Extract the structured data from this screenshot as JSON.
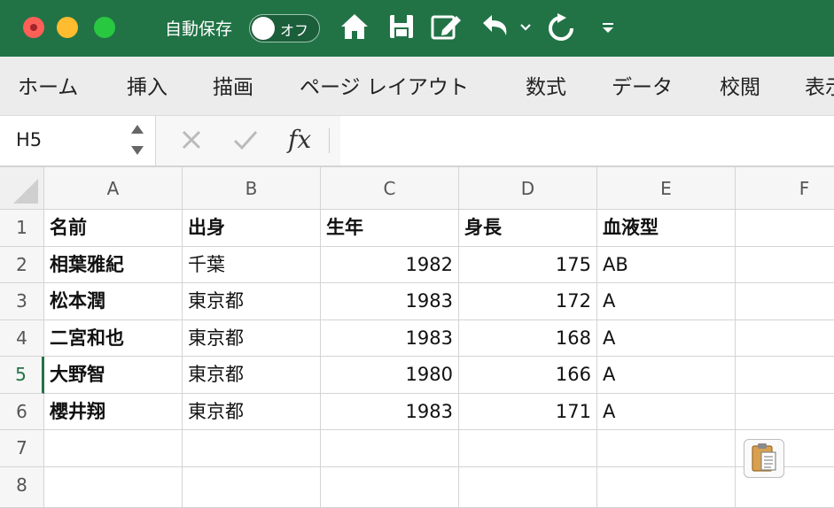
{
  "titlebar": {
    "autosave_label": "自動保存",
    "autosave_state": "オフ",
    "icons": [
      "home-icon",
      "save-icon",
      "edit-icon",
      "undo-icon",
      "undo-dropdown-icon",
      "redo-icon",
      "customize-toolbar-icon"
    ]
  },
  "ribbon": {
    "tabs": [
      "ホーム",
      "挿入",
      "描画",
      "ページ レイアウト",
      "数式",
      "データ",
      "校閲",
      "表示"
    ]
  },
  "formula_bar": {
    "cell_reference": "H5",
    "formula": ""
  },
  "sheet": {
    "columns": [
      "A",
      "B",
      "C",
      "D",
      "E",
      "F"
    ],
    "row_numbers": [
      "1",
      "2",
      "3",
      "4",
      "5",
      "6",
      "7",
      "8"
    ],
    "active_row": "5",
    "header_row": [
      "名前",
      "出身",
      "生年",
      "身長",
      "血液型"
    ],
    "rows": [
      [
        "相葉雅紀",
        "千葉",
        "1982",
        "175",
        "AB"
      ],
      [
        "松本潤",
        "東京都",
        "1983",
        "172",
        "A"
      ],
      [
        "二宮和也",
        "東京都",
        "1983",
        "168",
        "A"
      ],
      [
        "大野智",
        "東京都",
        "1980",
        "166",
        "A"
      ],
      [
        "櫻井翔",
        "東京都",
        "1983",
        "171",
        "A"
      ]
    ]
  },
  "colors": {
    "title_bar": "#217346",
    "ribbon": "#ececec",
    "active_row": "#217346"
  }
}
